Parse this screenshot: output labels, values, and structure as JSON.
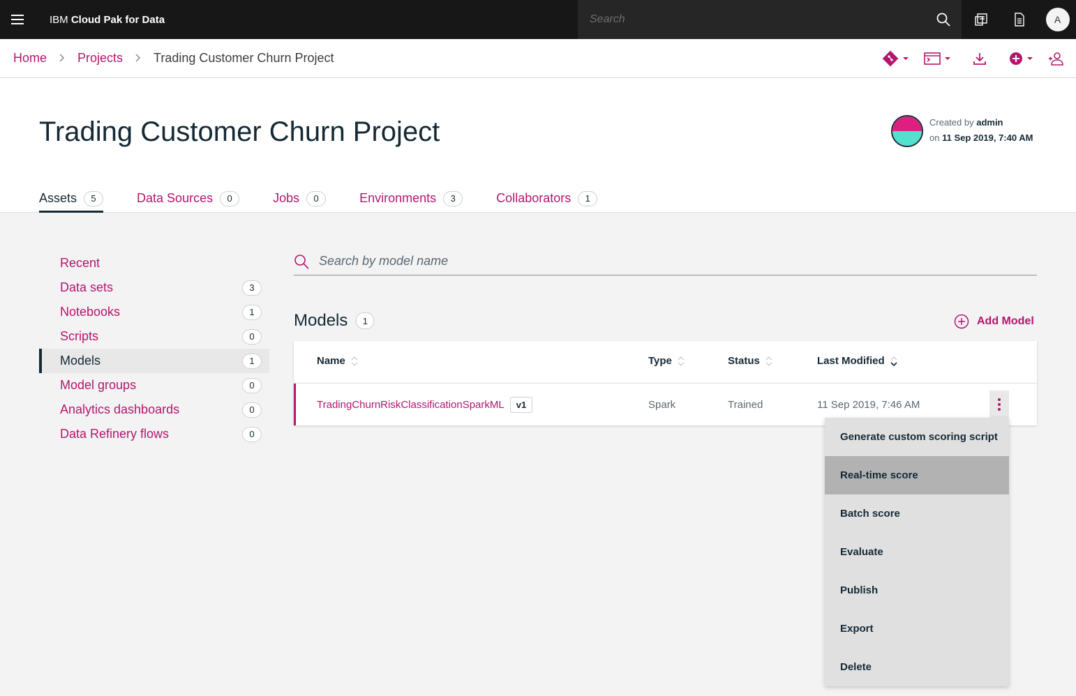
{
  "topbar": {
    "brand_prefix": "IBM",
    "brand_name": "Cloud Pak for Data",
    "search_placeholder": "Search",
    "user_initial": "A"
  },
  "breadcrumb": {
    "home": "Home",
    "projects": "Projects",
    "current": "Trading Customer Churn Project"
  },
  "project": {
    "title": "Trading Customer Churn Project",
    "created_by_label": "Created by",
    "created_by": "admin",
    "on_label": "on",
    "created_on": "11 Sep 2019, 7:40 AM"
  },
  "tabs": [
    {
      "label": "Assets",
      "count": "5"
    },
    {
      "label": "Data Sources",
      "count": "0"
    },
    {
      "label": "Jobs",
      "count": "0"
    },
    {
      "label": "Environments",
      "count": "3"
    },
    {
      "label": "Collaborators",
      "count": "1"
    }
  ],
  "sidebar": {
    "items": [
      {
        "label": "Recent",
        "count": ""
      },
      {
        "label": "Data sets",
        "count": "3"
      },
      {
        "label": "Notebooks",
        "count": "1"
      },
      {
        "label": "Scripts",
        "count": "0"
      },
      {
        "label": "Models",
        "count": "1"
      },
      {
        "label": "Model groups",
        "count": "0"
      },
      {
        "label": "Analytics dashboards",
        "count": "0"
      },
      {
        "label": "Data Refinery flows",
        "count": "0"
      }
    ]
  },
  "main": {
    "search_placeholder": "Search by model name",
    "section_title": "Models",
    "section_count": "1",
    "add_label": "Add Model",
    "columns": [
      "Name",
      "Type",
      "Status",
      "Last Modified"
    ],
    "rows": [
      {
        "name": "TradingChurnRiskClassificationSparkML",
        "version": "v1",
        "type": "Spark",
        "status": "Trained",
        "modified": "11 Sep 2019, 7:46 AM"
      }
    ]
  },
  "overflow_menu": {
    "items": [
      "Generate custom scoring script",
      "Real-time score",
      "Batch score",
      "Evaluate",
      "Publish",
      "Export",
      "Delete"
    ],
    "highlighted": "Real-time score"
  },
  "colors": {
    "accent": "#b3166e",
    "text": "#152935",
    "topbar": "#171717"
  }
}
